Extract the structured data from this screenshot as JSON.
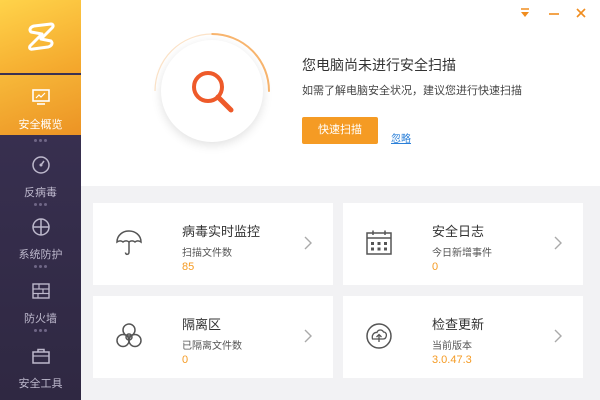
{
  "window": {
    "menu_icon": "dropdown-triangle-icon",
    "minimize_icon": "minimize-icon",
    "close_icon": "close-icon",
    "accent_color": "#f59b24"
  },
  "sidebar": {
    "logo_icon": "app-logo-icon",
    "items": [
      {
        "label": "安全概览",
        "icon": "monitor-icon",
        "active": true
      },
      {
        "label": "反病毒",
        "icon": "gauge-icon",
        "active": false
      },
      {
        "label": "系统防护",
        "icon": "crosshair-icon",
        "active": false
      },
      {
        "label": "防火墙",
        "icon": "firewall-icon",
        "active": false
      },
      {
        "label": "安全工具",
        "icon": "toolbox-icon",
        "active": false
      }
    ]
  },
  "status": {
    "title": "您电脑尚未进行安全扫描",
    "description": "如需了解电脑安全状况，建议您进行快速扫描",
    "quick_scan_label": "快速扫描",
    "ignore_label": "忽略"
  },
  "cards": [
    {
      "title": "病毒实时监控",
      "subtitle": "扫描文件数",
      "value": "85",
      "icon": "umbrella-icon"
    },
    {
      "title": "安全日志",
      "subtitle": "今日新增事件",
      "value": "0",
      "icon": "calendar-icon"
    },
    {
      "title": "隔离区",
      "subtitle": "已隔离文件数",
      "value": "0",
      "icon": "biohazard-icon"
    },
    {
      "title": "检查更新",
      "subtitle": "当前版本",
      "value": "3.0.47.3",
      "icon": "update-icon"
    }
  ]
}
